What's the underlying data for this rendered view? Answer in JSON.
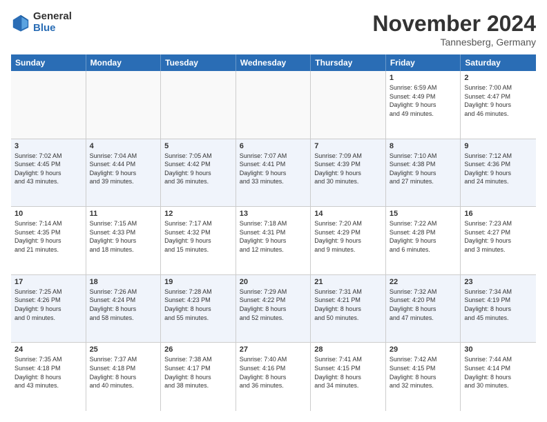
{
  "logo": {
    "general": "General",
    "blue": "Blue"
  },
  "title": "November 2024",
  "location": "Tannesberg, Germany",
  "header_days": [
    "Sunday",
    "Monday",
    "Tuesday",
    "Wednesday",
    "Thursday",
    "Friday",
    "Saturday"
  ],
  "weeks": [
    [
      {
        "day": "",
        "info": "",
        "empty": true
      },
      {
        "day": "",
        "info": "",
        "empty": true
      },
      {
        "day": "",
        "info": "",
        "empty": true
      },
      {
        "day": "",
        "info": "",
        "empty": true
      },
      {
        "day": "",
        "info": "",
        "empty": true
      },
      {
        "day": "1",
        "info": "Sunrise: 6:59 AM\nSunset: 4:49 PM\nDaylight: 9 hours\nand 49 minutes."
      },
      {
        "day": "2",
        "info": "Sunrise: 7:00 AM\nSunset: 4:47 PM\nDaylight: 9 hours\nand 46 minutes."
      }
    ],
    [
      {
        "day": "3",
        "info": "Sunrise: 7:02 AM\nSunset: 4:45 PM\nDaylight: 9 hours\nand 43 minutes."
      },
      {
        "day": "4",
        "info": "Sunrise: 7:04 AM\nSunset: 4:44 PM\nDaylight: 9 hours\nand 39 minutes."
      },
      {
        "day": "5",
        "info": "Sunrise: 7:05 AM\nSunset: 4:42 PM\nDaylight: 9 hours\nand 36 minutes."
      },
      {
        "day": "6",
        "info": "Sunrise: 7:07 AM\nSunset: 4:41 PM\nDaylight: 9 hours\nand 33 minutes."
      },
      {
        "day": "7",
        "info": "Sunrise: 7:09 AM\nSunset: 4:39 PM\nDaylight: 9 hours\nand 30 minutes."
      },
      {
        "day": "8",
        "info": "Sunrise: 7:10 AM\nSunset: 4:38 PM\nDaylight: 9 hours\nand 27 minutes."
      },
      {
        "day": "9",
        "info": "Sunrise: 7:12 AM\nSunset: 4:36 PM\nDaylight: 9 hours\nand 24 minutes."
      }
    ],
    [
      {
        "day": "10",
        "info": "Sunrise: 7:14 AM\nSunset: 4:35 PM\nDaylight: 9 hours\nand 21 minutes."
      },
      {
        "day": "11",
        "info": "Sunrise: 7:15 AM\nSunset: 4:33 PM\nDaylight: 9 hours\nand 18 minutes."
      },
      {
        "day": "12",
        "info": "Sunrise: 7:17 AM\nSunset: 4:32 PM\nDaylight: 9 hours\nand 15 minutes."
      },
      {
        "day": "13",
        "info": "Sunrise: 7:18 AM\nSunset: 4:31 PM\nDaylight: 9 hours\nand 12 minutes."
      },
      {
        "day": "14",
        "info": "Sunrise: 7:20 AM\nSunset: 4:29 PM\nDaylight: 9 hours\nand 9 minutes."
      },
      {
        "day": "15",
        "info": "Sunrise: 7:22 AM\nSunset: 4:28 PM\nDaylight: 9 hours\nand 6 minutes."
      },
      {
        "day": "16",
        "info": "Sunrise: 7:23 AM\nSunset: 4:27 PM\nDaylight: 9 hours\nand 3 minutes."
      }
    ],
    [
      {
        "day": "17",
        "info": "Sunrise: 7:25 AM\nSunset: 4:26 PM\nDaylight: 9 hours\nand 0 minutes."
      },
      {
        "day": "18",
        "info": "Sunrise: 7:26 AM\nSunset: 4:24 PM\nDaylight: 8 hours\nand 58 minutes."
      },
      {
        "day": "19",
        "info": "Sunrise: 7:28 AM\nSunset: 4:23 PM\nDaylight: 8 hours\nand 55 minutes."
      },
      {
        "day": "20",
        "info": "Sunrise: 7:29 AM\nSunset: 4:22 PM\nDaylight: 8 hours\nand 52 minutes."
      },
      {
        "day": "21",
        "info": "Sunrise: 7:31 AM\nSunset: 4:21 PM\nDaylight: 8 hours\nand 50 minutes."
      },
      {
        "day": "22",
        "info": "Sunrise: 7:32 AM\nSunset: 4:20 PM\nDaylight: 8 hours\nand 47 minutes."
      },
      {
        "day": "23",
        "info": "Sunrise: 7:34 AM\nSunset: 4:19 PM\nDaylight: 8 hours\nand 45 minutes."
      }
    ],
    [
      {
        "day": "24",
        "info": "Sunrise: 7:35 AM\nSunset: 4:18 PM\nDaylight: 8 hours\nand 43 minutes."
      },
      {
        "day": "25",
        "info": "Sunrise: 7:37 AM\nSunset: 4:18 PM\nDaylight: 8 hours\nand 40 minutes."
      },
      {
        "day": "26",
        "info": "Sunrise: 7:38 AM\nSunset: 4:17 PM\nDaylight: 8 hours\nand 38 minutes."
      },
      {
        "day": "27",
        "info": "Sunrise: 7:40 AM\nSunset: 4:16 PM\nDaylight: 8 hours\nand 36 minutes."
      },
      {
        "day": "28",
        "info": "Sunrise: 7:41 AM\nSunset: 4:15 PM\nDaylight: 8 hours\nand 34 minutes."
      },
      {
        "day": "29",
        "info": "Sunrise: 7:42 AM\nSunset: 4:15 PM\nDaylight: 8 hours\nand 32 minutes."
      },
      {
        "day": "30",
        "info": "Sunrise: 7:44 AM\nSunset: 4:14 PM\nDaylight: 8 hours\nand 30 minutes."
      }
    ]
  ]
}
